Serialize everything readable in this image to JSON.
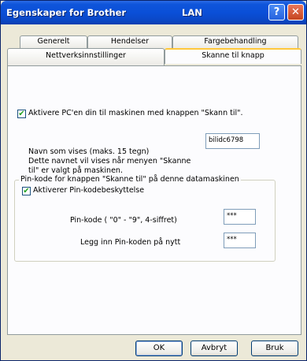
{
  "window": {
    "title": "Egenskaper for Brother",
    "title_right": "LAN",
    "help_glyph": "?",
    "close_glyph": "✕"
  },
  "tabs": {
    "row_back": [
      "Generelt",
      "Hendelser",
      "Fargebehandling"
    ],
    "row_front": [
      "Nettverksinnstillinger",
      "Skanne til knapp"
    ],
    "active": "Skanne til knapp"
  },
  "scan_to": {
    "enable_label": "Aktivere PC'en din til maskinen med knappen \"Skann til\".",
    "enable_checked": true,
    "display_name_desc_line1": "Navn som vises (maks. 15 tegn)",
    "display_name_desc_line2": "Dette navnet vil vises når menyen \"Skanne",
    "display_name_desc_line3": "til\" er valgt på maskinen.",
    "display_name_value": "bilidc6798"
  },
  "pin": {
    "group_title": "Pin-kode for knappen \"Skanne til\" på denne datamaskinen",
    "protect_label": "Aktiverer Pin-kodebeskyttelse",
    "protect_checked": true,
    "pin_label": "Pin-kode ( \"0\" - \"9\", 4-siffret)",
    "pin_value": "***",
    "pin_repeat_label": "Legg inn Pin-koden på nytt",
    "pin_repeat_value": "***"
  },
  "buttons": {
    "ok": "OK",
    "cancel": "Avbryt",
    "apply": "Bruk"
  },
  "colors": {
    "titlebar": "#0A4FD8",
    "tab_highlight": "#FFC83C",
    "dialog_bg": "#ECE9D8"
  }
}
